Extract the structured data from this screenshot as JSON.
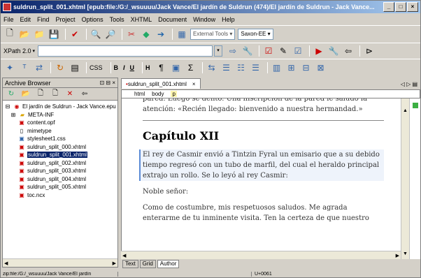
{
  "window": {
    "title": "suldrun_split_001.xhtml [epub:file:/G:/_wsuuuu/Jack Vance/El jardín de Suldrun (474)/El jardín de Suldrun - Jack Vance..."
  },
  "menu": [
    "File",
    "Edit",
    "Find",
    "Project",
    "Options",
    "Tools",
    "XHTML",
    "Document",
    "Window",
    "Help"
  ],
  "toolbar1": {
    "external_tools": "External Tools",
    "saxon": "Saxon-EE"
  },
  "toolbar2": {
    "xpath_label": "XPath 2.0",
    "xpath_value": ""
  },
  "toolbar3": {
    "css_label": "CSS",
    "bold": "B",
    "italic": "I",
    "underline": "U",
    "heading": "H"
  },
  "archive": {
    "title": "Archive Browser",
    "items": [
      {
        "label": "El jardín de Suldrun - Jack Vance.epu",
        "icon": "book-icon",
        "level": 0
      },
      {
        "label": "META-INF",
        "icon": "folder-icon",
        "level": 1
      },
      {
        "label": "content.opf",
        "icon": "file-icon",
        "level": 2
      },
      {
        "label": "mimetype",
        "icon": "file-icon",
        "level": 2
      },
      {
        "label": "stylesheet1.css",
        "icon": "file-icon",
        "level": 2
      },
      {
        "label": "suldrun_split_000.xhtml",
        "icon": "file-icon",
        "level": 2
      },
      {
        "label": "suldrun_split_001.xhtml",
        "icon": "file-icon",
        "level": 2,
        "selected": true
      },
      {
        "label": "suldrun_split_002.xhtml",
        "icon": "file-icon",
        "level": 2
      },
      {
        "label": "suldrun_split_003.xhtml",
        "icon": "file-icon",
        "level": 2
      },
      {
        "label": "suldrun_split_004.xhtml",
        "icon": "file-icon",
        "level": 2
      },
      {
        "label": "suldrun_split_005.xhtml",
        "icon": "file-icon",
        "level": 2
      },
      {
        "label": "toc.ncx",
        "icon": "file-icon",
        "level": 2
      }
    ]
  },
  "editor": {
    "tab_label": "suldrun_split_001.xhtml",
    "breadcrumb": [
      "html",
      "body",
      "p"
    ],
    "para_top": "pared. Luego se dentó. Una inscripción de la pared le saludó la atención: «Recién llegado: bienvenido a nuestra hermandad.»",
    "chapter": "Capítulo XII",
    "para1": "El rey de Casmir envió a Tintzin Fyral un emisario que a su debido tiempo regresó con un tubo de marfil, del cual el heraldo principal extrajo un rollo. Se lo leyó al rey Casmir:",
    "para2": "Noble señor:",
    "para3": "Como de costumbre, mis respetuosos saludos. Me agrada enterarme de tu inminente visita. Ten la certeza de que nuestro"
  },
  "modes": [
    "Text",
    "Grid",
    "Author"
  ],
  "status": {
    "path": "zip:file:/G:/_wsuuuu/Jack Vance/El jardín",
    "encoding": "U+0061"
  },
  "colors": {
    "titlebar_start": "#0a246a",
    "selection": "#0a246a",
    "highlight_para": "#eef3fb"
  }
}
